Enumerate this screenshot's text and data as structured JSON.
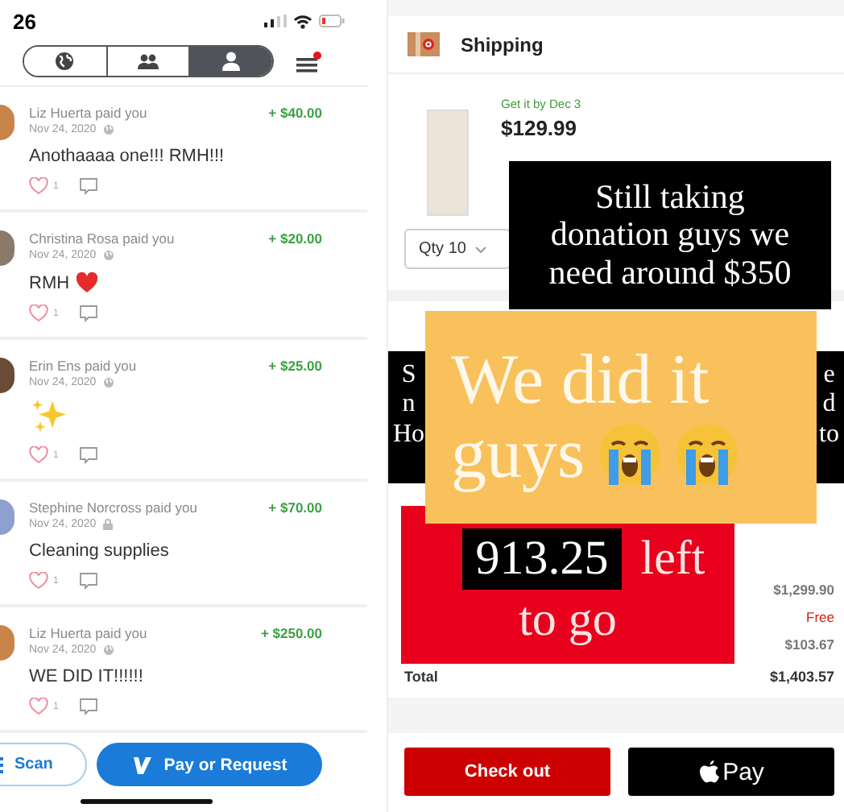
{
  "payment_app": {
    "status_bar": {
      "time": "26"
    },
    "tabs": [
      {
        "kind": "globe",
        "selected": false
      },
      {
        "kind": "friends",
        "selected": false
      },
      {
        "kind": "person",
        "selected": true
      }
    ],
    "menu": {
      "notification": true
    },
    "feed": [
      {
        "name": "Liz Huerta",
        "action": "paid you",
        "amount": "+ $40.00",
        "date": "Nov 24, 2020",
        "private": false,
        "message": "Anothaaaa one!!! RMH!!!",
        "likes": "1"
      },
      {
        "name": "Christina Rosa",
        "action": "paid you",
        "amount": "+ $20.00",
        "date": "Nov 24, 2020",
        "private": false,
        "message": "RMH",
        "emoji": {
          "kind": "heart"
        },
        "likes": "1"
      },
      {
        "name": "Erin Ens",
        "action": "paid you",
        "amount": "+ $25.00",
        "date": "Nov 24, 2020",
        "private": false,
        "emoji": {
          "kind": "sparkles"
        },
        "likes": "1"
      },
      {
        "name": "Stephine Norcross",
        "action": "paid you",
        "amount": "+ $70.00",
        "date": "Nov 24, 2020",
        "private": true,
        "message": "Cleaning supplies",
        "likes": "1"
      },
      {
        "name": "Liz Huerta",
        "action": "paid you",
        "amount": "+ $250.00",
        "date": "Nov 24, 2020",
        "private": false,
        "message": "WE DID IT!!!!!!",
        "likes": "1"
      }
    ],
    "scan_button": "Scan",
    "pay_button": "Pay or Request"
  },
  "cart_app": {
    "section": "Shipping",
    "delivery": "Get it by Dec 3",
    "price": "$129.99",
    "quantity": "Qty 10",
    "summary": [
      {
        "value": "$1,299.90",
        "kind": "amount"
      },
      {
        "value": "Free",
        "kind": "free"
      },
      {
        "value": "$103.67",
        "kind": "amount"
      }
    ],
    "total_label": "Total",
    "total": "$1,403.57",
    "checkout_button": "Check out",
    "pay_button": "Pay"
  },
  "note_sticker": {
    "lines": [
      "Still taking",
      "donation guys we",
      "need around $350"
    ]
  },
  "banner_fragments": {
    "left": [
      "S",
      "n",
      "Ho"
    ],
    "right": [
      "e",
      "d",
      "to"
    ]
  },
  "celebration_sticker": {
    "lines": [
      "We did it",
      "guys"
    ],
    "emoji": {
      "kind": "crying"
    }
  },
  "goal_sticker": {
    "amount": "913.25",
    "word": "left",
    "line2": "to go"
  }
}
